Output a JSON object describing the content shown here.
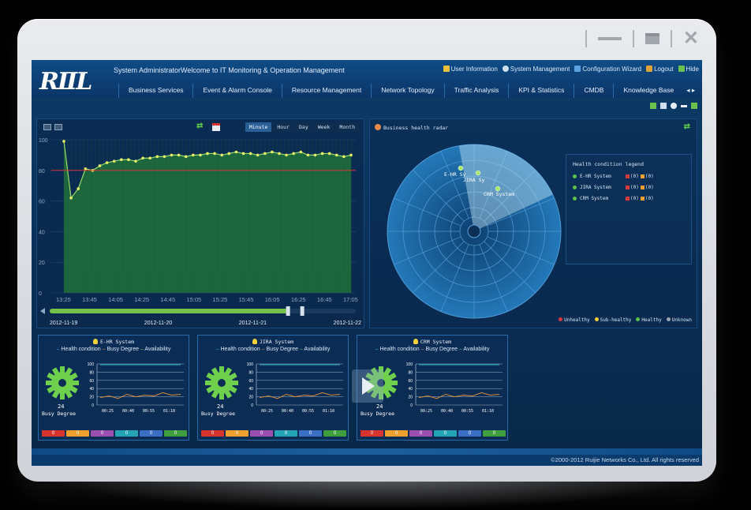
{
  "app": {
    "logo_text": "RⅡL",
    "welcome": "System AdministratorWelcome to IT Monitoring & Operation Management",
    "user_links": [
      "User Information",
      "System Management",
      "Configuration Wizard",
      "Logout",
      "Hide"
    ],
    "nav": [
      "Business Services",
      "Event & Alarm Console",
      "Resource Management",
      "Network Topology",
      "Traffic Analysis",
      "KPI & Statistics",
      "CMDB",
      "Knowledge Base"
    ],
    "nav_more": "◂ ▸",
    "footer": "©2000-2012 Ruijie Networks Co., Ltd. All rights reserved"
  },
  "window_controls": {
    "close": "✕"
  },
  "trend": {
    "tabs": [
      "Minute",
      "Hour",
      "Day",
      "Week",
      "Month"
    ],
    "active_tab": "Minute",
    "dates": [
      "2012-11-19",
      "2012-11-20",
      "2012-11-21",
      "2012-11-22"
    ],
    "slider_position": 0.78
  },
  "chart_data": {
    "type": "line",
    "x": [
      "13:25",
      "13:45",
      "14:05",
      "14:25",
      "14:45",
      "15:05",
      "15:25",
      "15:45",
      "16:05",
      "16:25",
      "16:45",
      "17:05"
    ],
    "ylim": [
      0,
      100
    ],
    "yticks": [
      0,
      20,
      40,
      60,
      80,
      100
    ],
    "threshold": 80,
    "values": [
      99,
      62,
      68,
      81,
      80,
      83,
      85,
      86,
      87,
      87,
      86,
      88,
      88,
      89,
      89,
      90,
      90,
      89,
      90,
      90,
      91,
      91,
      90,
      91,
      92,
      91,
      91,
      90,
      91,
      92,
      91,
      90,
      91,
      92,
      90,
      90,
      91,
      91,
      90,
      89,
      90
    ],
    "area_color": "#1f6d3c",
    "line_color": "#9ad96a",
    "threshold_color": "#d8342f"
  },
  "radar": {
    "title": "Business health radar",
    "legend_title": "Health condition legend",
    "systems": [
      {
        "name": "E-HR System",
        "label": "E-HR Sy",
        "counts": [
          "(0)",
          "(0)"
        ]
      },
      {
        "name": "JIRA System",
        "label": "JIRA Sy",
        "counts": [
          "(0)",
          "(0)"
        ]
      },
      {
        "name": "CRM System",
        "label": "CRM System",
        "counts": [
          "(0)",
          "(0)"
        ]
      }
    ],
    "status_legend": [
      {
        "label": "Unhealthy",
        "color": "#d83b3b"
      },
      {
        "label": "Sub-healthy",
        "color": "#f2d23a"
      },
      {
        "label": "Healthy",
        "color": "#59c04b"
      },
      {
        "label": "Unknown",
        "color": "#9aa6b3"
      }
    ]
  },
  "cards": [
    {
      "title": "E-HR System",
      "busy": "24"
    },
    {
      "title": "JIRA System",
      "busy": "24"
    },
    {
      "title": "CRM System",
      "busy": "24"
    }
  ],
  "card_common": {
    "legend_health": "Health condition",
    "legend_busy": "Busy Degree",
    "legend_avail": "Availability",
    "busy_label": "Busy Degree",
    "yticks": [
      "100",
      "80",
      "60",
      "40",
      "20",
      "0"
    ],
    "xticks": [
      "00:25",
      "00:40",
      "00:55",
      "01:10"
    ],
    "buttons": [
      {
        "text": "0",
        "color": "#d8342f"
      },
      {
        "text": "0",
        "color": "#f0a02f"
      },
      {
        "text": "0",
        "color": "#9b4fb0"
      },
      {
        "text": "0",
        "color": "#25a4b5"
      },
      {
        "text": "0",
        "color": "#3b6fc6"
      },
      {
        "text": "0",
        "color": "#3f9f3f"
      }
    ],
    "busy_series": [
      18,
      22,
      16,
      26,
      20,
      24,
      22,
      30,
      24,
      26
    ],
    "avail_series": [
      98,
      98,
      98,
      98,
      98,
      98,
      98,
      98,
      98,
      98
    ]
  }
}
